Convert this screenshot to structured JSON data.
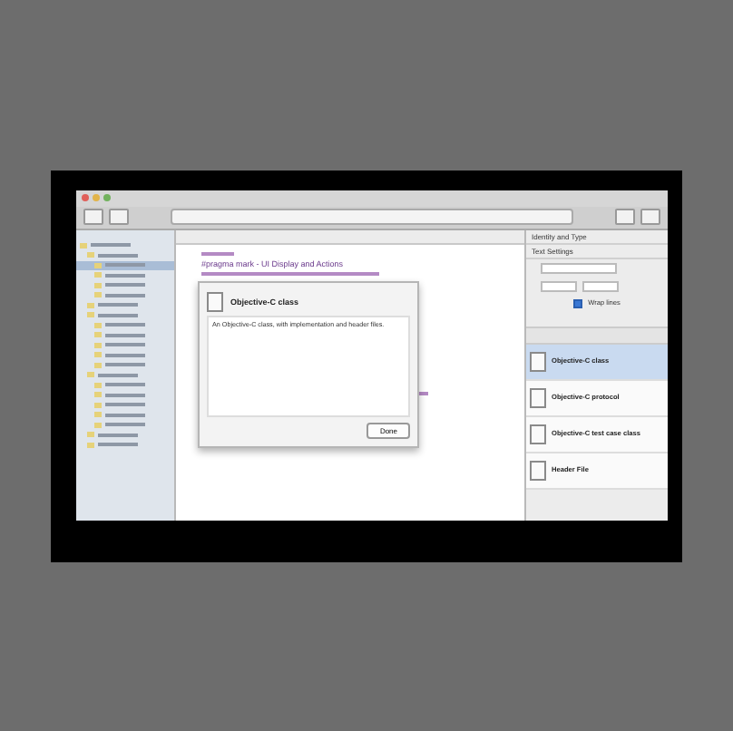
{
  "editor": {
    "code_line": "#pragma mark - UI Display and Actions"
  },
  "dialog": {
    "title": "Objective-C class",
    "description": "An Objective-C class, with implementation and header files.",
    "button": "Done"
  },
  "inspector": {
    "sections": [
      "Identity and Type",
      "Text Settings"
    ],
    "wrap_lines": {
      "label": "Wrap lines",
      "checked": true
    }
  },
  "library": [
    {
      "title": "Objective-C class",
      "selected": true
    },
    {
      "title": "Objective-C protocol",
      "selected": false
    },
    {
      "title": "Objective-C test case class",
      "selected": false
    },
    {
      "title": "Header File",
      "selected": false
    }
  ],
  "navigator": [
    {
      "selected": false,
      "children": [
        {
          "selected": false,
          "children": [
            {
              "selected": true
            },
            {
              "selected": false
            },
            {
              "selected": false
            },
            {
              "selected": false
            }
          ]
        },
        {
          "selected": false
        },
        {
          "selected": false,
          "children": [
            {
              "selected": false
            },
            {
              "selected": false
            },
            {
              "selected": false
            },
            {
              "selected": false
            },
            {
              "selected": false
            }
          ]
        },
        {
          "selected": false,
          "children": [
            {
              "selected": false
            },
            {
              "selected": false
            },
            {
              "selected": false
            },
            {
              "selected": false
            },
            {
              "selected": false
            }
          ]
        },
        {
          "selected": false
        },
        {
          "selected": false
        }
      ]
    }
  ]
}
